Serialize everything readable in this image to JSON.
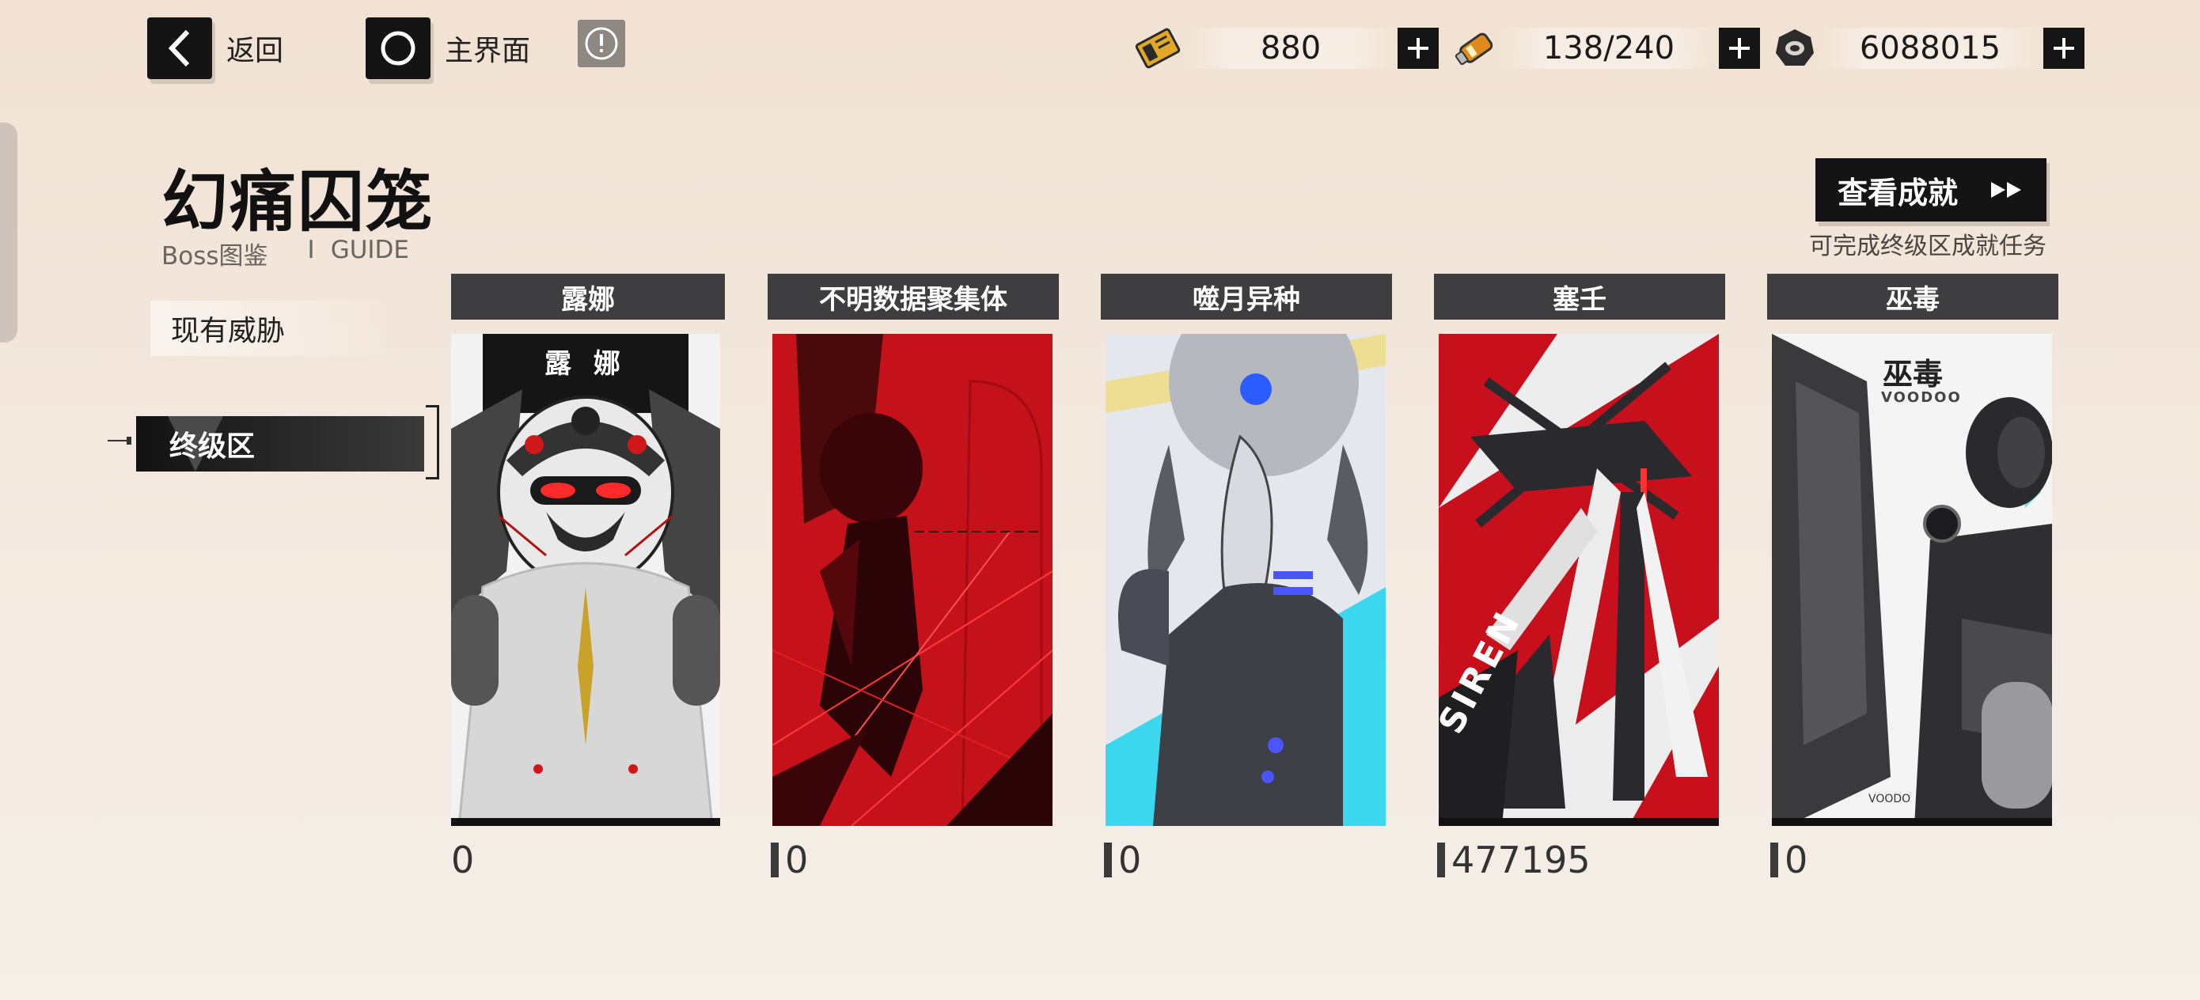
{
  "nav": {
    "back_label": "返回",
    "home_label": "主界面"
  },
  "resources": [
    {
      "icon": "ticket-icon",
      "value": "880"
    },
    {
      "icon": "battery-icon",
      "value": "138/240"
    },
    {
      "icon": "gear-coin-icon",
      "value": "6088015"
    }
  ],
  "page": {
    "title": "幻痛囚笼",
    "subtitle_cn": "Boss图鉴",
    "subtitle_sep": "I",
    "subtitle_en": "GUIDE"
  },
  "sidebar": {
    "items": [
      {
        "label": "现有威胁",
        "selected": false
      },
      {
        "label": "终级区",
        "selected": true
      }
    ]
  },
  "achievement": {
    "button_label": "查看成就",
    "hint": "可完成终级区成就任务"
  },
  "bosses": [
    {
      "name": "露娜",
      "score": "0",
      "art_text": "露 娜",
      "colors": [
        "#f2f2f2",
        "#1a1a1a",
        "#d01818"
      ]
    },
    {
      "name": "不明数据聚集体",
      "score": "0",
      "colors": [
        "#c5121a",
        "#3a0508"
      ]
    },
    {
      "name": "噬月异种",
      "score": "0",
      "colors": [
        "#d9dde3",
        "#4a4c55",
        "#3ad7ef"
      ]
    },
    {
      "name": "塞壬",
      "score": "477195",
      "art_text": "SIREN",
      "colors": [
        "#c8101c",
        "#2a2a2e",
        "#ededed"
      ]
    },
    {
      "name": "巫毒",
      "score": "0",
      "art_text": "巫毒",
      "art_sub": "VOODOO",
      "art_foot": "VOODO",
      "colors": [
        "#f4f4f4",
        "#2a2a2c",
        "#6fd8e6"
      ]
    }
  ]
}
